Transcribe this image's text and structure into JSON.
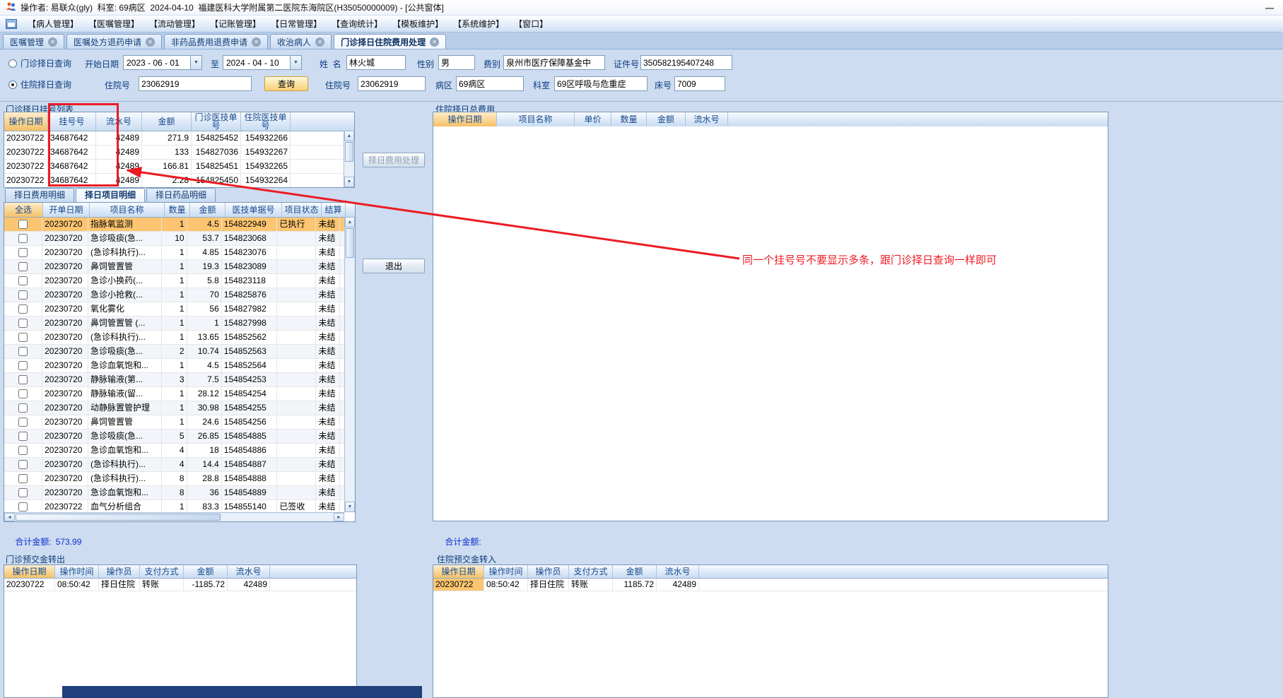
{
  "window": {
    "title": "操作者: 易联众(gly)  科室: 69病区  2024-04-10  福建医科大学附属第二医院东海院区(H35050000009) - [公共窗体]"
  },
  "menu": {
    "items": [
      "【病人管理】",
      "【医嘱管理】",
      "【流动管理】",
      "【记账管理】",
      "【日常管理】",
      "【查询统计】",
      "【模板维护】",
      "【系统维护】",
      "【窗口】"
    ]
  },
  "tabs": [
    {
      "label": "医嘱管理"
    },
    {
      "label": "医嘱处方退药申请"
    },
    {
      "label": "非药品费用退费申请"
    },
    {
      "label": "收治病人"
    },
    {
      "label": "门诊择日住院费用处理",
      "selected": true
    }
  ],
  "query": {
    "radio_outpatient": "门诊择日查询",
    "radio_inpatient": "住院择日查询",
    "labels": {
      "start_date": "开始日期",
      "to": "至",
      "name": "姓  名",
      "gender": "性别",
      "fee_type": "费别",
      "id_no": "证件号",
      "inpatient_no": "住院号",
      "inpatient_no2": "住院号",
      "ward": "病区",
      "dept": "科室",
      "bed": "床号"
    },
    "start_date": "2023 - 06 - 01",
    "end_date": "2024 - 04 - 10",
    "name": "林火城",
    "gender": "男",
    "fee_type": "泉州市医疗保障基金中",
    "id_no": "350582195407248",
    "inpatient_no_input": "23062919",
    "query_button": "查询",
    "inpatient_no": "23062919",
    "ward": "69病区",
    "dept": "69区呼吸与危重症",
    "bed": "7009"
  },
  "reg_list": {
    "title": "门诊择日挂号列表",
    "columns": [
      "操作日期",
      "挂号号",
      "流水号",
      "金额",
      "门诊医技单号",
      "住院医技单号"
    ],
    "rows": [
      {
        "date": "20230722",
        "reg_no": "34687642",
        "serial": "42489",
        "amount": "271.9",
        "outp_doc": "154825452",
        "inp_doc": "154932266"
      },
      {
        "date": "20230722",
        "reg_no": "34687642",
        "serial": "42489",
        "amount": "133",
        "outp_doc": "154827036",
        "inp_doc": "154932267"
      },
      {
        "date": "20230722",
        "reg_no": "34687642",
        "serial": "42489",
        "amount": "166.81",
        "outp_doc": "154825451",
        "inp_doc": "154932265"
      },
      {
        "date": "20230722",
        "reg_no": "34687642",
        "serial": "42489",
        "amount": "2.28",
        "outp_doc": "154825450",
        "inp_doc": "154932264"
      }
    ]
  },
  "detail_tabs": [
    {
      "label": "择日费用明细"
    },
    {
      "label": "择日项目明细",
      "selected": true
    },
    {
      "label": "择日药品明细"
    }
  ],
  "detail": {
    "columns": [
      "全选",
      "开单日期",
      "项目名称",
      "数量",
      "金额",
      "医技单据号",
      "项目状态",
      "结算"
    ],
    "rows": [
      {
        "date": "20230720",
        "name": "指脉氧监测",
        "qty": "1",
        "amount": "4.5",
        "doc_no": "154822949",
        "status": "已执行",
        "settle": "未结",
        "selected": true
      },
      {
        "date": "20230720",
        "name": "急诊吸痰(急...",
        "qty": "10",
        "amount": "53.7",
        "doc_no": "154823068",
        "status": "",
        "settle": "未结"
      },
      {
        "date": "20230720",
        "name": "(急诊科执行)...",
        "qty": "1",
        "amount": "4.85",
        "doc_no": "154823076",
        "status": "",
        "settle": "未结"
      },
      {
        "date": "20230720",
        "name": "鼻饲管置管",
        "qty": "1",
        "amount": "19.3",
        "doc_no": "154823089",
        "status": "",
        "settle": "未结"
      },
      {
        "date": "20230720",
        "name": "急诊小换药(...",
        "qty": "1",
        "amount": "5.8",
        "doc_no": "154823118",
        "status": "",
        "settle": "未结"
      },
      {
        "date": "20230720",
        "name": "急诊小抢救(...",
        "qty": "1",
        "amount": "70",
        "doc_no": "154825876",
        "status": "",
        "settle": "未结"
      },
      {
        "date": "20230720",
        "name": "氧化雾化",
        "qty": "1",
        "amount": "56",
        "doc_no": "154827982",
        "status": "",
        "settle": "未结"
      },
      {
        "date": "20230720",
        "name": "鼻饲管置管 (...",
        "qty": "1",
        "amount": "1",
        "doc_no": "154827998",
        "status": "",
        "settle": "未结"
      },
      {
        "date": "20230720",
        "name": "(急诊科执行)...",
        "qty": "1",
        "amount": "13.65",
        "doc_no": "154852562",
        "status": "",
        "settle": "未结"
      },
      {
        "date": "20230720",
        "name": "急诊吸痰(急...",
        "qty": "2",
        "amount": "10.74",
        "doc_no": "154852563",
        "status": "",
        "settle": "未结"
      },
      {
        "date": "20230720",
        "name": "急诊血氧饱和...",
        "qty": "1",
        "amount": "4.5",
        "doc_no": "154852564",
        "status": "",
        "settle": "未结"
      },
      {
        "date": "20230720",
        "name": "静脉输液(第...",
        "qty": "3",
        "amount": "7.5",
        "doc_no": "154854253",
        "status": "",
        "settle": "未结"
      },
      {
        "date": "20230720",
        "name": "静脉输液(留...",
        "qty": "1",
        "amount": "28.12",
        "doc_no": "154854254",
        "status": "",
        "settle": "未结"
      },
      {
        "date": "20230720",
        "name": "动静脉置管护理",
        "qty": "1",
        "amount": "30.98",
        "doc_no": "154854255",
        "status": "",
        "settle": "未结"
      },
      {
        "date": "20230720",
        "name": "鼻饲管置管",
        "qty": "1",
        "amount": "24.6",
        "doc_no": "154854256",
        "status": "",
        "settle": "未结"
      },
      {
        "date": "20230720",
        "name": "急诊吸痰(急...",
        "qty": "5",
        "amount": "26.85",
        "doc_no": "154854885",
        "status": "",
        "settle": "未结"
      },
      {
        "date": "20230720",
        "name": "急诊血氧饱和...",
        "qty": "4",
        "amount": "18",
        "doc_no": "154854886",
        "status": "",
        "settle": "未结"
      },
      {
        "date": "20230720",
        "name": "(急诊科执行)...",
        "qty": "4",
        "amount": "14.4",
        "doc_no": "154854887",
        "status": "",
        "settle": "未结"
      },
      {
        "date": "20230720",
        "name": "(急诊科执行)...",
        "qty": "8",
        "amount": "28.8",
        "doc_no": "154854888",
        "status": "",
        "settle": "未结"
      },
      {
        "date": "20230720",
        "name": "急诊血氧饱和...",
        "qty": "8",
        "amount": "36",
        "doc_no": "154854889",
        "status": "",
        "settle": "未结"
      },
      {
        "date": "20230722",
        "name": "血气分析组合",
        "qty": "1",
        "amount": "83.3",
        "doc_no": "154855140",
        "status": "已签收",
        "settle": "未结"
      }
    ],
    "total_label": "合计金额:",
    "total_value": "573.99"
  },
  "actions": {
    "process": "择日费用处理",
    "exit": "退出"
  },
  "inpatient_fees": {
    "title": "住院择日总费用",
    "columns": [
      "操作日期",
      "项目名称",
      "单价",
      "数量",
      "金额",
      "流水号"
    ],
    "total_label": "合计金额:"
  },
  "prepay_out": {
    "title": "门诊预交金转出",
    "columns": [
      "操作日期",
      "操作时间",
      "操作员",
      "支付方式",
      "金额",
      "流水号"
    ],
    "rows": [
      {
        "date": "20230722",
        "time": "08:50:42",
        "operator": "择日住院",
        "pay_method": "转账",
        "amount": "-1185.72",
        "serial": "42489"
      }
    ]
  },
  "prepay_in": {
    "title": "住院预交金转入",
    "columns": [
      "操作日期",
      "操作时间",
      "操作员",
      "支付方式",
      "金额",
      "流水号"
    ],
    "rows": [
      {
        "date": "20230722",
        "time": "08:50:42",
        "operator": "择日住院",
        "pay_method": "转账",
        "amount": "1185.72",
        "serial": "42489",
        "selected": true
      }
    ]
  },
  "annotation": {
    "note": "同一个挂号号不要显示多条，跟门诊择日查询一样即可",
    "color": "#ec1b23"
  }
}
